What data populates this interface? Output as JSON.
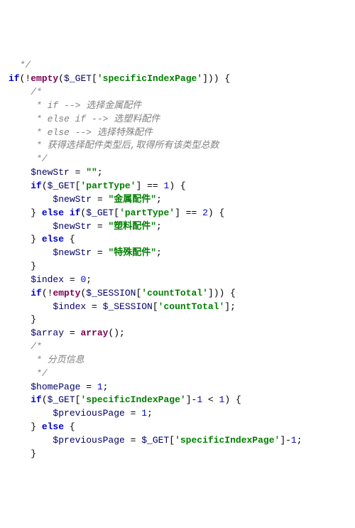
{
  "code": {
    "l01": "  */",
    "l02a": "if",
    "l02b": "(!",
    "l02c": "empty",
    "l02d": "(",
    "l02e": "$_GET",
    "l02f": "[",
    "l02g": "'specificIndexPage'",
    "l02h": "])) {",
    "l03": "    /*",
    "l04": "     * if --> 选择金属配件",
    "l05": "     * else if --> 选塑料配件",
    "l06": "     * else --> 选择特殊配件",
    "l07": "     * 获得选择配件类型后,取得所有该类型总数",
    "l08": "     */",
    "l09a": "    ",
    "l09b": "$newStr",
    "l09c": " = ",
    "l09d": "\"\"",
    "l09e": ";",
    "l10a": "    ",
    "l10b": "if",
    "l10c": "(",
    "l10d": "$_GET",
    "l10e": "[",
    "l10f": "'partType'",
    "l10g": "] == ",
    "l10h": "1",
    "l10i": ") {",
    "l11a": "        ",
    "l11b": "$newStr",
    "l11c": " = ",
    "l11d": "\"金属配件\"",
    "l11e": ";",
    "l12a": "    } ",
    "l12b": "else if",
    "l12c": "(",
    "l12d": "$_GET",
    "l12e": "[",
    "l12f": "'partType'",
    "l12g": "] == ",
    "l12h": "2",
    "l12i": ") {",
    "l13a": "        ",
    "l13b": "$newStr",
    "l13c": " = ",
    "l13d": "\"塑料配件\"",
    "l13e": ";",
    "l14a": "    } ",
    "l14b": "else",
    "l14c": " {",
    "l15a": "        ",
    "l15b": "$newStr",
    "l15c": " = ",
    "l15d": "\"特殊配件\"",
    "l15e": ";",
    "l16": "    }",
    "l17a": "    ",
    "l17b": "$index",
    "l17c": " = ",
    "l17d": "0",
    "l17e": ";",
    "l18a": "    ",
    "l18b": "if",
    "l18c": "(!",
    "l18d": "empty",
    "l18e": "(",
    "l18f": "$_SESSION",
    "l18g": "[",
    "l18h": "'countTotal'",
    "l18i": "])) {",
    "l19a": "        ",
    "l19b": "$index",
    "l19c": " = ",
    "l19d": "$_SESSION",
    "l19e": "[",
    "l19f": "'countTotal'",
    "l19g": "];",
    "l20": "    }",
    "l21a": "    ",
    "l21b": "$array",
    "l21c": " = ",
    "l21d": "array",
    "l21e": "();",
    "l22": "    /*",
    "l23": "     * 分页信息",
    "l24": "     */",
    "l25a": "    ",
    "l25b": "$homePage",
    "l25c": " = ",
    "l25d": "1",
    "l25e": ";",
    "l26a": "    ",
    "l26b": "if",
    "l26c": "(",
    "l26d": "$_GET",
    "l26e": "[",
    "l26f": "'specificIndexPage'",
    "l26g": "]-",
    "l26h": "1",
    "l26i": " < ",
    "l26j": "1",
    "l26k": ") {",
    "l27a": "        ",
    "l27b": "$previousPage",
    "l27c": " = ",
    "l27d": "1",
    "l27e": ";",
    "l28a": "    } ",
    "l28b": "else",
    "l28c": " {",
    "l29a": "        ",
    "l29b": "$previousPage",
    "l29c": " = ",
    "l29d": "$_GET",
    "l29e": "[",
    "l29f": "'specificIndexPage'",
    "l29g": "]-",
    "l29h": "1",
    "l29i": ";",
    "l30": "    }"
  }
}
